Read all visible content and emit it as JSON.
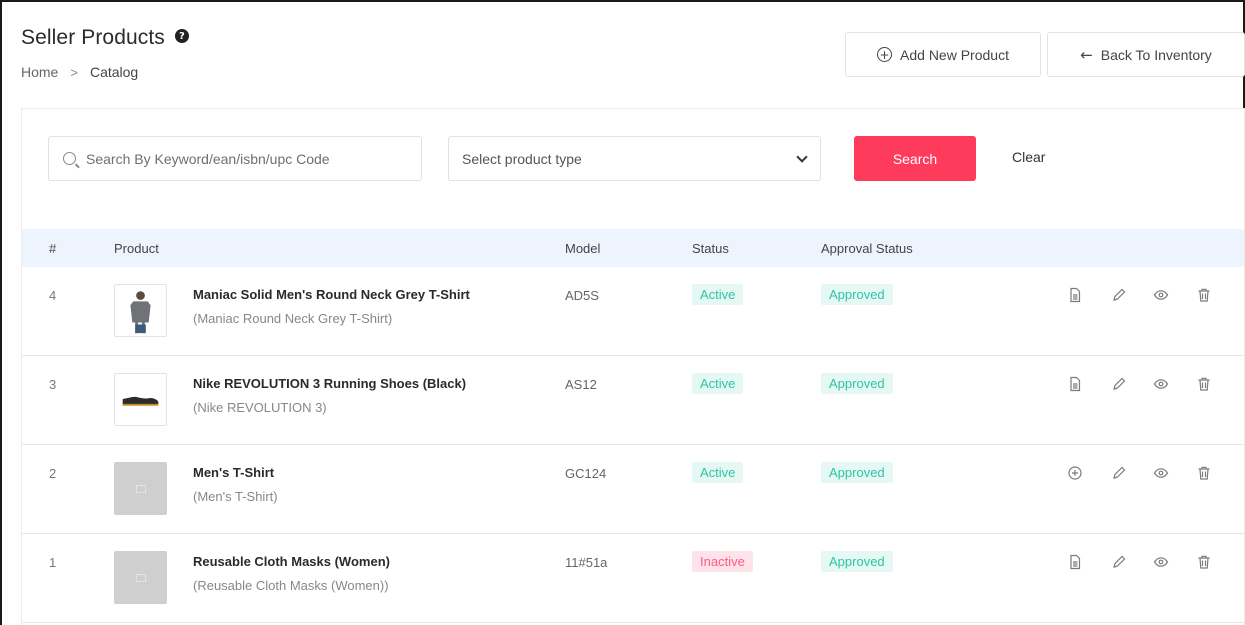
{
  "header": {
    "title": "Seller Products",
    "breadcrumb": {
      "home": "Home",
      "separator": ">",
      "current": "Catalog"
    }
  },
  "actions": {
    "add_label": "Add New Product",
    "back_label": "Back To Inventory"
  },
  "filters": {
    "search_placeholder": "Search By Keyword/ean/isbn/upc Code",
    "select_value": "Select product type",
    "search_button": "Search",
    "clear_button": "Clear"
  },
  "table": {
    "columns": [
      "#",
      "Product",
      "Model",
      "Status",
      "Approval Status"
    ],
    "rows": [
      {
        "index": "4",
        "name": "Maniac Solid Men's Round Neck Grey T-Shirt",
        "subtitle": "(Maniac Round Neck Grey T-Shirt)",
        "model": "AD5S",
        "status": "Active",
        "approval": "Approved",
        "thumb": "tshirt-grey",
        "first_action_icon": "document-icon"
      },
      {
        "index": "3",
        "name": "Nike REVOLUTION 3 Running Shoes (Black)",
        "subtitle": "(Nike REVOLUTION 3)",
        "model": "AS12",
        "status": "Active",
        "approval": "Approved",
        "thumb": "shoe-black",
        "first_action_icon": "document-icon"
      },
      {
        "index": "2",
        "name": "Men's T-Shirt",
        "subtitle": "(Men's T-Shirt)",
        "model": "GC124",
        "status": "Active",
        "approval": "Approved",
        "thumb": "placeholder",
        "first_action_icon": "add-circle-icon"
      },
      {
        "index": "1",
        "name": "Reusable Cloth Masks (Women)",
        "subtitle": "(Reusable Cloth Masks (Women))",
        "model": "11#51a",
        "status": "Inactive",
        "approval": "Approved",
        "thumb": "placeholder",
        "first_action_icon": "document-icon"
      }
    ]
  },
  "colors": {
    "primary": "#ff3b5c",
    "active_text": "#2ec4a4",
    "active_bg": "#e6f8f4",
    "inactive_text": "#ff5b84",
    "inactive_bg": "#ffe3ea",
    "table_header_bg": "#eef4fd"
  }
}
